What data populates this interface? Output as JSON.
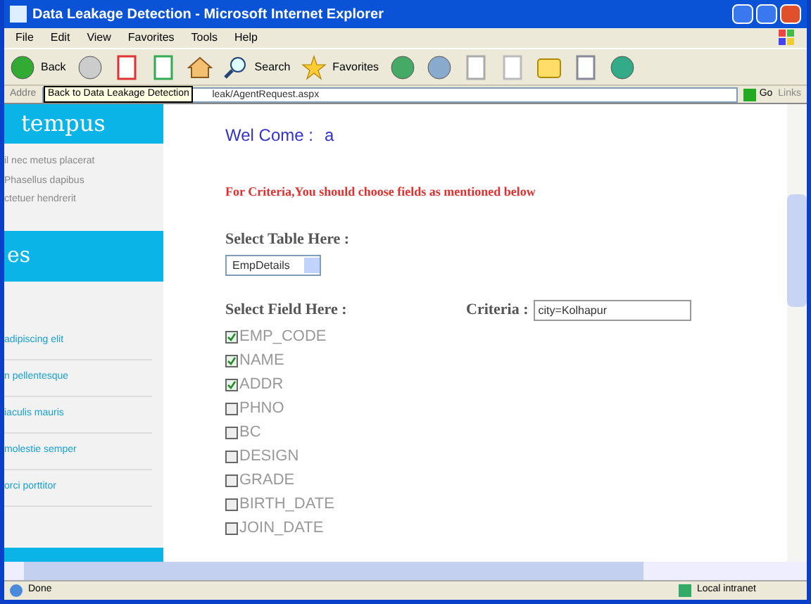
{
  "window": {
    "title": "Data Leakage Detection - Microsoft Internet Explorer"
  },
  "menu": [
    "File",
    "Edit",
    "View",
    "Favorites",
    "Tools",
    "Help"
  ],
  "toolbar": {
    "back": "Back",
    "search": "Search",
    "favorites": "Favorites"
  },
  "address_bar": {
    "label": "Addre",
    "url": "leak/AgentRequest.aspx",
    "go": "Go",
    "links": "Links"
  },
  "tooltip": "Back to Data Leakage Detection",
  "sidebar": {
    "header_1": "tempus",
    "paragraph": [
      "il nec metus placerat",
      "Phasellus   dapibus",
      "ctetuer hendrerit"
    ],
    "header_2": "es",
    "items": [
      "adipiscing elit",
      "n pellentesque",
      "iaculis mauris",
      "molestie semper",
      "orci porttitor"
    ]
  },
  "page": {
    "welcome": "Wel Come :",
    "user": "a",
    "notice": "For Criteria,You should choose fields as mentioned below",
    "table_label": "Select Table Here :",
    "table_value": "EmpDetails",
    "field_label": "Select Field Here :",
    "criteria_label": "Criteria :",
    "criteria_value": "city=Kolhapur",
    "fields": [
      {
        "label": "EMP_CODE",
        "checked": true
      },
      {
        "label": "NAME",
        "checked": true
      },
      {
        "label": "ADDR",
        "checked": true
      },
      {
        "label": "PHNO",
        "checked": false
      },
      {
        "label": "BC",
        "checked": false
      },
      {
        "label": "DESIGN",
        "checked": false
      },
      {
        "label": "GRADE",
        "checked": false
      },
      {
        "label": "BIRTH_DATE",
        "checked": false
      },
      {
        "label": "JOIN_DATE",
        "checked": false
      }
    ]
  },
  "status_bar": {
    "text": "Done",
    "zone": "Local intranet"
  }
}
